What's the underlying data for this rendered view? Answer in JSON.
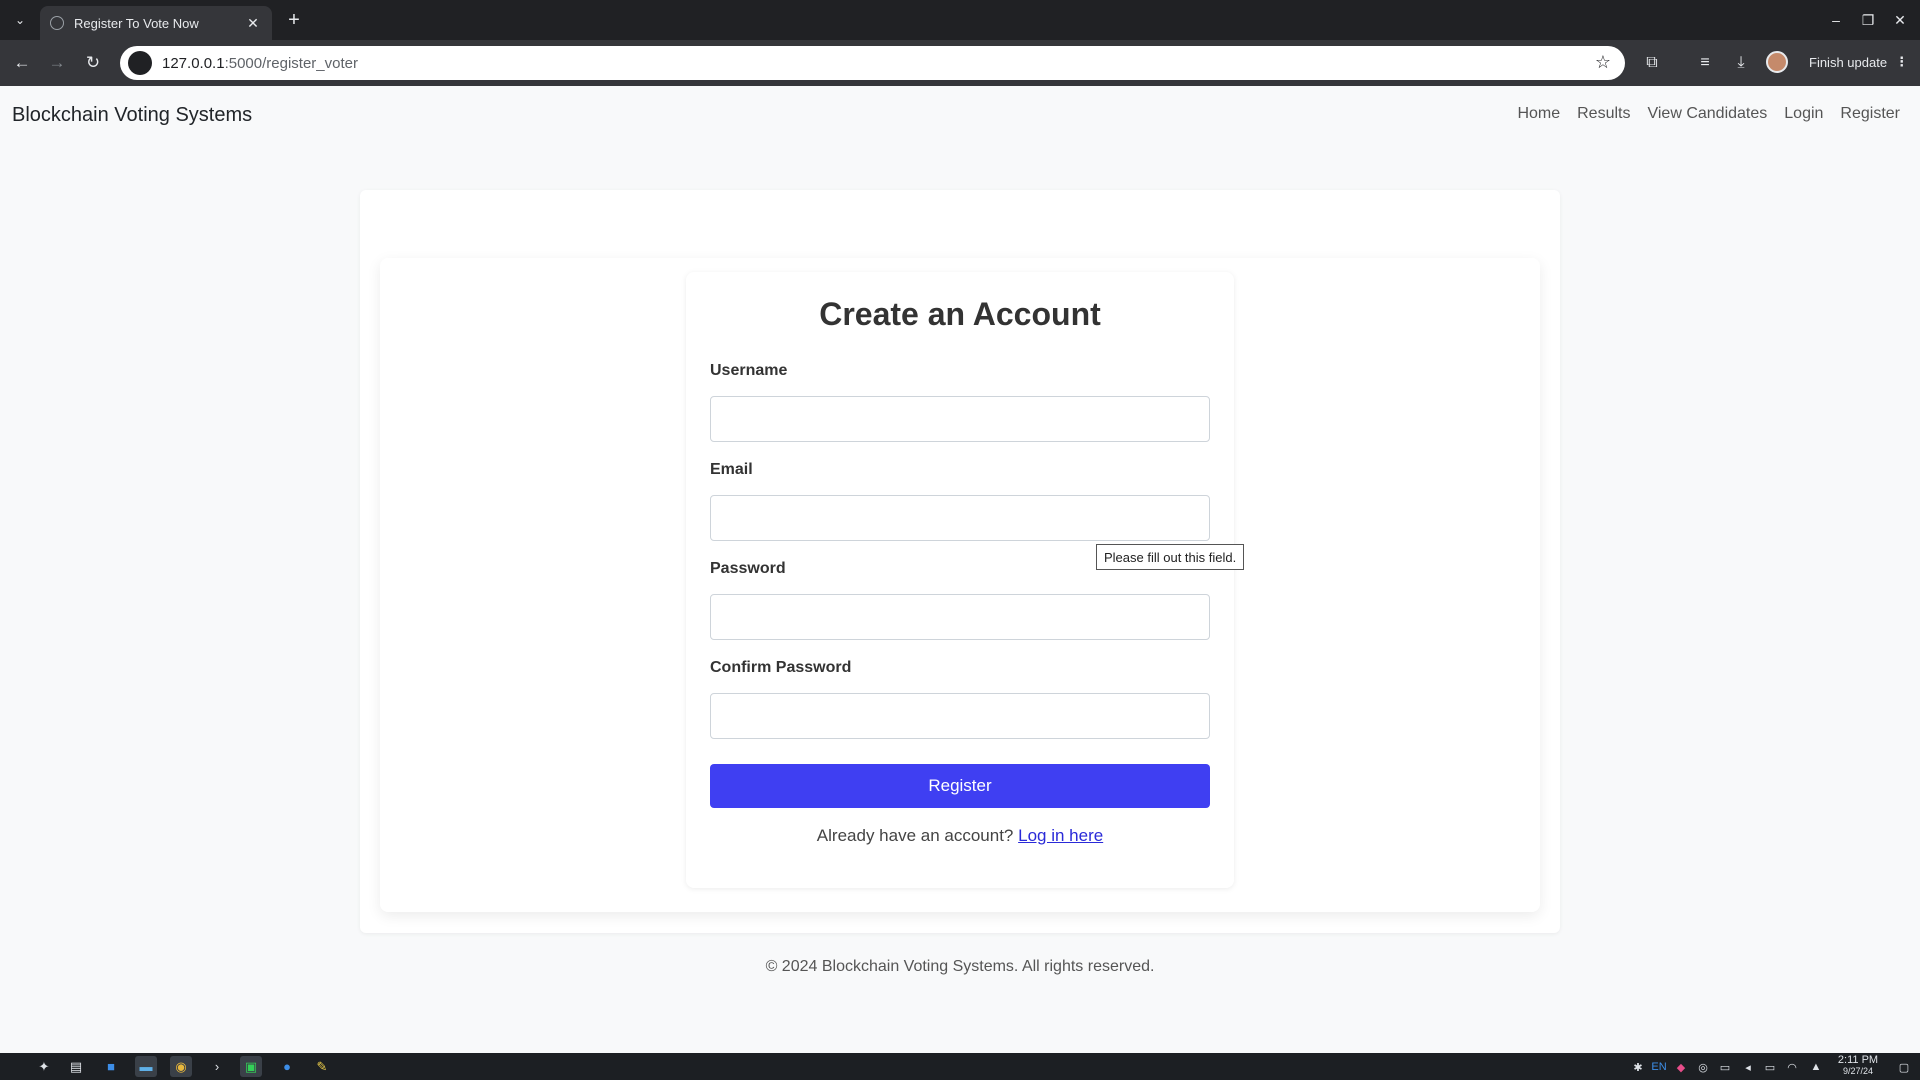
{
  "browser": {
    "tab_title": "Register To Vote Now",
    "url_host": "127.0.0.1",
    "url_path": ":5000/register_voter",
    "finish_update_label": "Finish update"
  },
  "site": {
    "brand": "Blockchain Voting Systems",
    "nav": [
      "Home",
      "Results",
      "View Candidates",
      "Login",
      "Register"
    ]
  },
  "form": {
    "title": "Create an Account",
    "fields": [
      {
        "label": "Username",
        "value": ""
      },
      {
        "label": "Email",
        "value": ""
      },
      {
        "label": "Password",
        "value": ""
      },
      {
        "label": "Confirm Password",
        "value": ""
      }
    ],
    "submit_label": "Register",
    "login_prompt": "Already have an account?",
    "login_link": "Log in here",
    "validation_tooltip": "Please fill out this field."
  },
  "footer": {
    "text": "© 2024 Blockchain Voting Systems. All rights reserved."
  },
  "taskbar": {
    "time": "2:11 PM",
    "date": "9/27/24",
    "language": "EN"
  },
  "colors": {
    "primary_button": "#3f3ff2",
    "link": "#2a2ad8",
    "page_background": "#f8f9fa"
  }
}
